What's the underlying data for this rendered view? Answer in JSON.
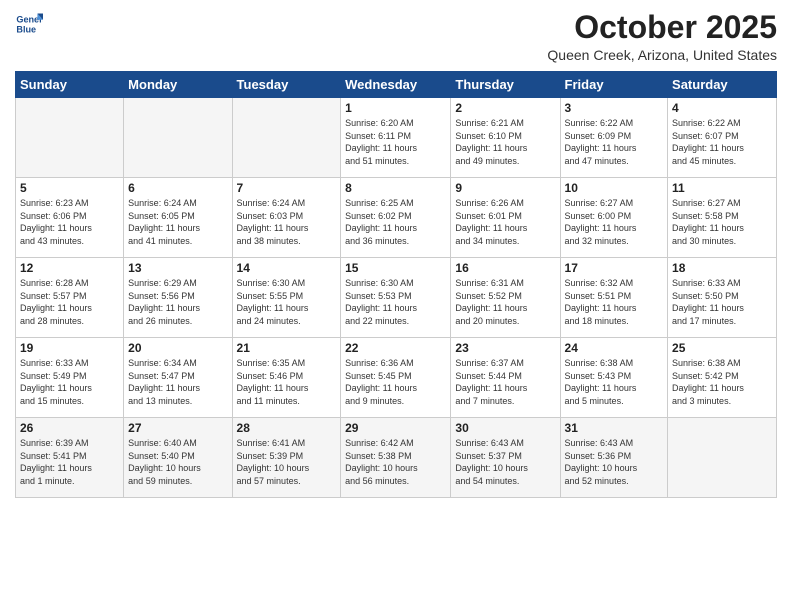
{
  "header": {
    "logo_line1": "General",
    "logo_line2": "Blue",
    "month": "October 2025",
    "location": "Queen Creek, Arizona, United States"
  },
  "weekdays": [
    "Sunday",
    "Monday",
    "Tuesday",
    "Wednesday",
    "Thursday",
    "Friday",
    "Saturday"
  ],
  "weeks": [
    [
      {
        "day": "",
        "info": ""
      },
      {
        "day": "",
        "info": ""
      },
      {
        "day": "",
        "info": ""
      },
      {
        "day": "1",
        "info": "Sunrise: 6:20 AM\nSunset: 6:11 PM\nDaylight: 11 hours\nand 51 minutes."
      },
      {
        "day": "2",
        "info": "Sunrise: 6:21 AM\nSunset: 6:10 PM\nDaylight: 11 hours\nand 49 minutes."
      },
      {
        "day": "3",
        "info": "Sunrise: 6:22 AM\nSunset: 6:09 PM\nDaylight: 11 hours\nand 47 minutes."
      },
      {
        "day": "4",
        "info": "Sunrise: 6:22 AM\nSunset: 6:07 PM\nDaylight: 11 hours\nand 45 minutes."
      }
    ],
    [
      {
        "day": "5",
        "info": "Sunrise: 6:23 AM\nSunset: 6:06 PM\nDaylight: 11 hours\nand 43 minutes."
      },
      {
        "day": "6",
        "info": "Sunrise: 6:24 AM\nSunset: 6:05 PM\nDaylight: 11 hours\nand 41 minutes."
      },
      {
        "day": "7",
        "info": "Sunrise: 6:24 AM\nSunset: 6:03 PM\nDaylight: 11 hours\nand 38 minutes."
      },
      {
        "day": "8",
        "info": "Sunrise: 6:25 AM\nSunset: 6:02 PM\nDaylight: 11 hours\nand 36 minutes."
      },
      {
        "day": "9",
        "info": "Sunrise: 6:26 AM\nSunset: 6:01 PM\nDaylight: 11 hours\nand 34 minutes."
      },
      {
        "day": "10",
        "info": "Sunrise: 6:27 AM\nSunset: 6:00 PM\nDaylight: 11 hours\nand 32 minutes."
      },
      {
        "day": "11",
        "info": "Sunrise: 6:27 AM\nSunset: 5:58 PM\nDaylight: 11 hours\nand 30 minutes."
      }
    ],
    [
      {
        "day": "12",
        "info": "Sunrise: 6:28 AM\nSunset: 5:57 PM\nDaylight: 11 hours\nand 28 minutes."
      },
      {
        "day": "13",
        "info": "Sunrise: 6:29 AM\nSunset: 5:56 PM\nDaylight: 11 hours\nand 26 minutes."
      },
      {
        "day": "14",
        "info": "Sunrise: 6:30 AM\nSunset: 5:55 PM\nDaylight: 11 hours\nand 24 minutes."
      },
      {
        "day": "15",
        "info": "Sunrise: 6:30 AM\nSunset: 5:53 PM\nDaylight: 11 hours\nand 22 minutes."
      },
      {
        "day": "16",
        "info": "Sunrise: 6:31 AM\nSunset: 5:52 PM\nDaylight: 11 hours\nand 20 minutes."
      },
      {
        "day": "17",
        "info": "Sunrise: 6:32 AM\nSunset: 5:51 PM\nDaylight: 11 hours\nand 18 minutes."
      },
      {
        "day": "18",
        "info": "Sunrise: 6:33 AM\nSunset: 5:50 PM\nDaylight: 11 hours\nand 17 minutes."
      }
    ],
    [
      {
        "day": "19",
        "info": "Sunrise: 6:33 AM\nSunset: 5:49 PM\nDaylight: 11 hours\nand 15 minutes."
      },
      {
        "day": "20",
        "info": "Sunrise: 6:34 AM\nSunset: 5:47 PM\nDaylight: 11 hours\nand 13 minutes."
      },
      {
        "day": "21",
        "info": "Sunrise: 6:35 AM\nSunset: 5:46 PM\nDaylight: 11 hours\nand 11 minutes."
      },
      {
        "day": "22",
        "info": "Sunrise: 6:36 AM\nSunset: 5:45 PM\nDaylight: 11 hours\nand 9 minutes."
      },
      {
        "day": "23",
        "info": "Sunrise: 6:37 AM\nSunset: 5:44 PM\nDaylight: 11 hours\nand 7 minutes."
      },
      {
        "day": "24",
        "info": "Sunrise: 6:38 AM\nSunset: 5:43 PM\nDaylight: 11 hours\nand 5 minutes."
      },
      {
        "day": "25",
        "info": "Sunrise: 6:38 AM\nSunset: 5:42 PM\nDaylight: 11 hours\nand 3 minutes."
      }
    ],
    [
      {
        "day": "26",
        "info": "Sunrise: 6:39 AM\nSunset: 5:41 PM\nDaylight: 11 hours\nand 1 minute."
      },
      {
        "day": "27",
        "info": "Sunrise: 6:40 AM\nSunset: 5:40 PM\nDaylight: 10 hours\nand 59 minutes."
      },
      {
        "day": "28",
        "info": "Sunrise: 6:41 AM\nSunset: 5:39 PM\nDaylight: 10 hours\nand 57 minutes."
      },
      {
        "day": "29",
        "info": "Sunrise: 6:42 AM\nSunset: 5:38 PM\nDaylight: 10 hours\nand 56 minutes."
      },
      {
        "day": "30",
        "info": "Sunrise: 6:43 AM\nSunset: 5:37 PM\nDaylight: 10 hours\nand 54 minutes."
      },
      {
        "day": "31",
        "info": "Sunrise: 6:43 AM\nSunset: 5:36 PM\nDaylight: 10 hours\nand 52 minutes."
      },
      {
        "day": "",
        "info": ""
      }
    ]
  ]
}
